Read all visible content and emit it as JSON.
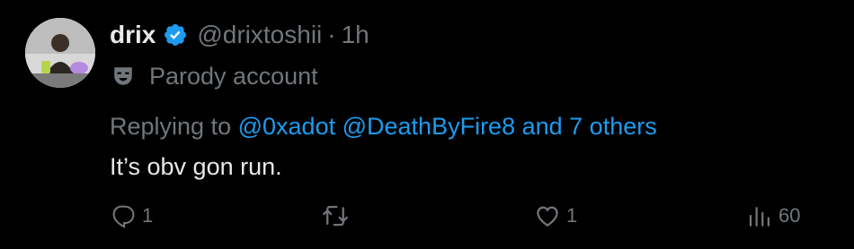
{
  "user": {
    "name": "drix",
    "handle": "@drixtoshii",
    "separator": "·",
    "time": "1h",
    "label": "Parody account"
  },
  "reply": {
    "prefix": "Replying to",
    "mention1": "@0xadot",
    "mention2": "@DeathByFire8",
    "others": "and 7 others"
  },
  "tweet": {
    "text": "It’s obv gon run."
  },
  "actions": {
    "replies": "1",
    "reposts": "",
    "likes": "1",
    "views": "60"
  },
  "colors": {
    "background": "#000000",
    "text": "#e7e9ea",
    "muted": "#71767b",
    "accent": "#1d9bf0"
  }
}
